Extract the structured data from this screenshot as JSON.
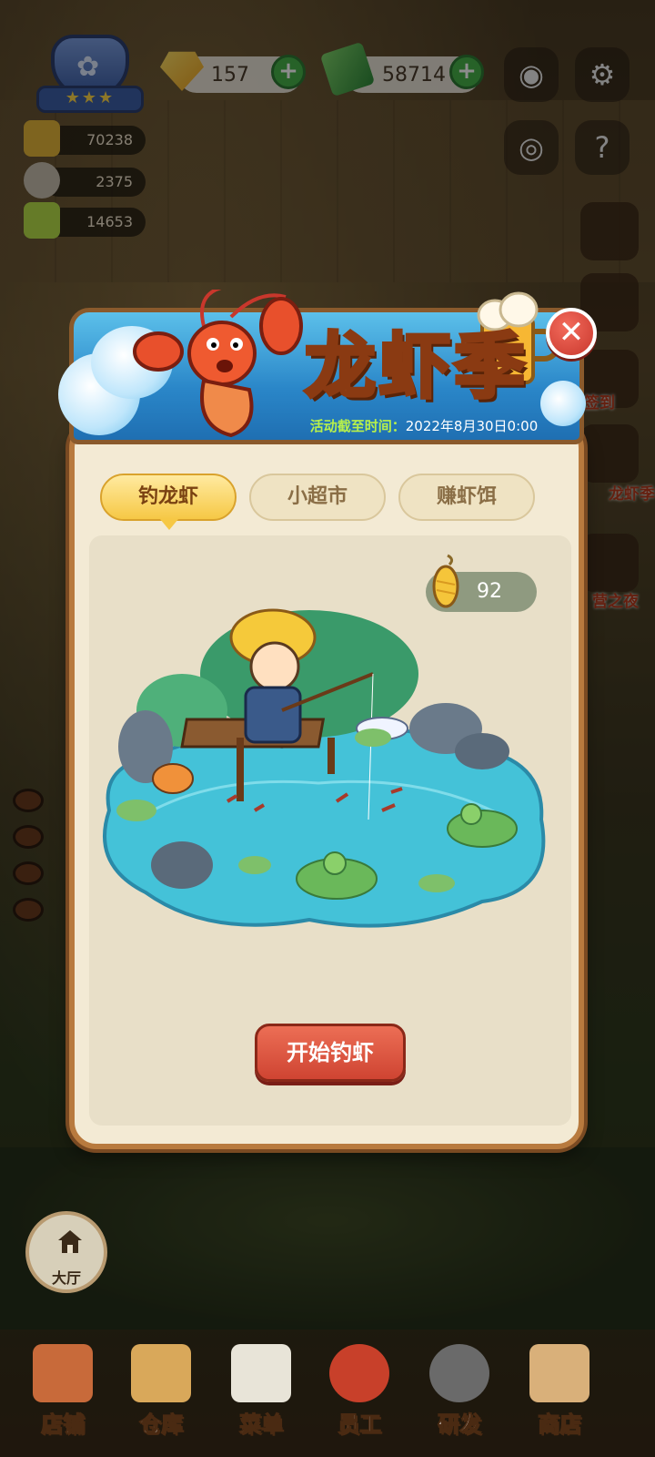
{
  "hud": {
    "rank_stars": "★★★",
    "gems": "157",
    "cash": "58714",
    "stats": [
      "70238",
      "2375",
      "14653"
    ]
  },
  "side_labels": [
    "签到",
    "龙虾季",
    "营之夜"
  ],
  "event": {
    "title": "龙虾季",
    "deadline_label": "活动截至时间：",
    "deadline_value": "2022年8月30日0:00",
    "close_icon": "✕",
    "tabs": [
      "钓龙虾",
      "小超市",
      "赚虾饵"
    ],
    "active_tab": 0,
    "bait_count": "92",
    "start_button": "开始钓虾"
  },
  "lobby": {
    "label": "大厅"
  },
  "bottom_nav": [
    "店铺",
    "仓库",
    "菜单",
    "员工",
    "研发",
    "商店"
  ],
  "colors": {
    "accent_gold": "#f6c845",
    "start_red": "#cf4432",
    "frame_brown": "#b87a3e",
    "pond_teal": "#3fc1d6"
  },
  "icons": {
    "gem": "gold-gem-icon",
    "cash": "cash-stack-icon",
    "camera": "camera-icon",
    "settings": "gear-icon",
    "eye": "eye-icon",
    "guide": "help-book-icon",
    "bait": "bait-float-icon",
    "lobby": "house-icon"
  }
}
